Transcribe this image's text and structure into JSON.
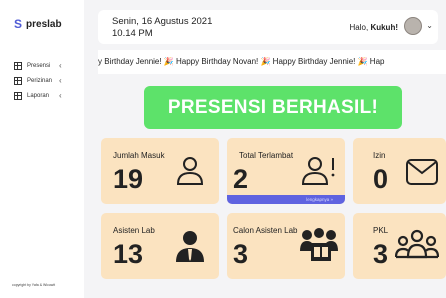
{
  "brand": {
    "logo_glyph": "S",
    "name": "preslab"
  },
  "sidebar": {
    "items": [
      {
        "label": "Presensi",
        "icon": "grid-icon"
      },
      {
        "label": "Perizinan",
        "icon": "grid-icon"
      },
      {
        "label": "Laporan",
        "icon": "grid-icon"
      }
    ],
    "copyright": "copyright by Yafa & Wicuwit"
  },
  "header": {
    "date": "Senin, 16 Agustus 2021",
    "time": "10.14 PM",
    "greeting": "Halo, ",
    "username": "Kukuh!"
  },
  "marquee": {
    "text": "y Birthday Jennie! 🎉   Happy Birthday Novan! 🎉   Happy Birthday Jennie! 🎉   Hap"
  },
  "banner": {
    "text": "PRESENSI BERHASIL!",
    "color": "#5de26a"
  },
  "cards": [
    {
      "title": "Jumlah Masuk",
      "value": "19",
      "icon": "person-outline-icon"
    },
    {
      "title": "Total Terlambat",
      "value": "2",
      "icon": "person-alert-icon",
      "sub": "lengkapnya »"
    },
    {
      "title": "Izin",
      "value": "0",
      "icon": "envelope-icon"
    },
    {
      "title": "Asisten Lab",
      "value": "13",
      "icon": "person-tie-icon"
    },
    {
      "title": "Calon Asisten Lab",
      "value": "3",
      "icon": "group-board-icon"
    },
    {
      "title": "PKL",
      "value": "3",
      "icon": "group-icon"
    }
  ],
  "colors": {
    "card_bg": "#fbe3c0",
    "accent": "#5f63e0"
  }
}
